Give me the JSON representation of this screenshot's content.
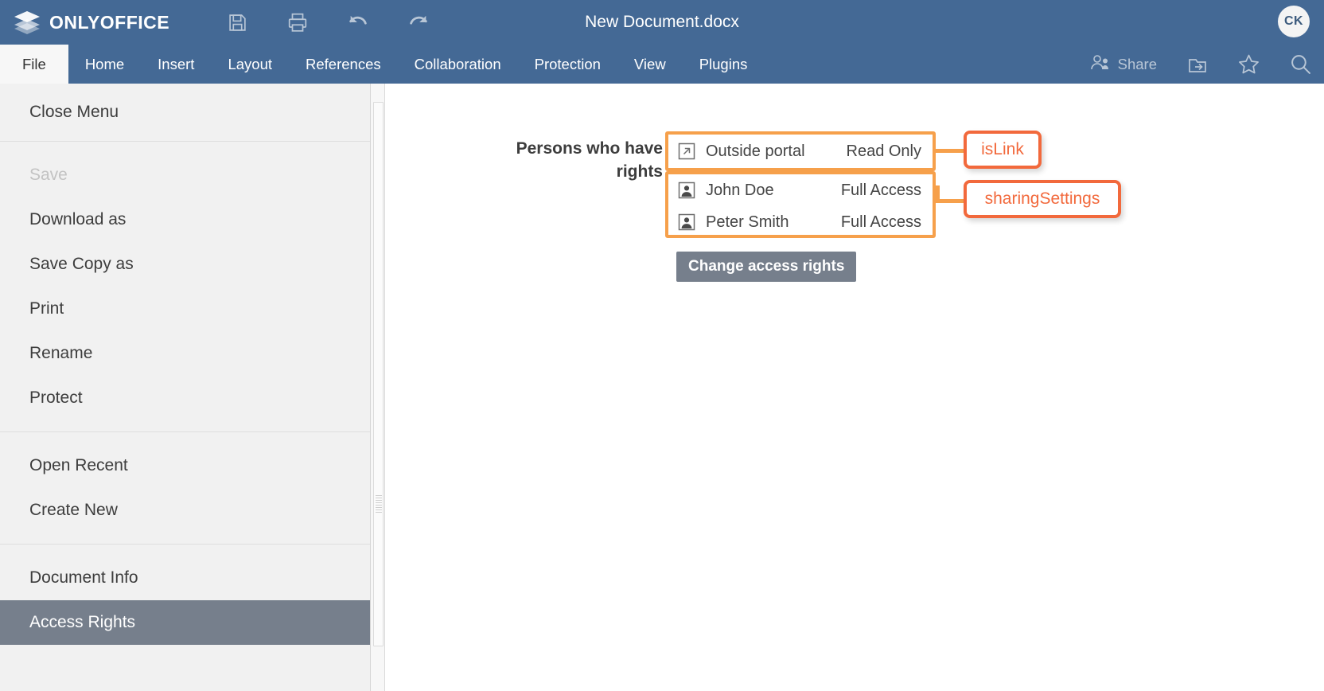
{
  "app": {
    "brand": "ONLYOFFICE",
    "logo_icon": "layers-stack-icon",
    "document_title": "New Document.docx",
    "avatar_initials": "CK"
  },
  "titlebar_tools": [
    {
      "name": "save-icon",
      "label": "Save"
    },
    {
      "name": "print-icon",
      "label": "Print"
    },
    {
      "name": "undo-icon",
      "label": "Undo"
    },
    {
      "name": "redo-icon",
      "label": "Redo"
    }
  ],
  "tabs": [
    {
      "label": "File",
      "active": true
    },
    {
      "label": "Home",
      "active": false
    },
    {
      "label": "Insert",
      "active": false
    },
    {
      "label": "Layout",
      "active": false
    },
    {
      "label": "References",
      "active": false
    },
    {
      "label": "Collaboration",
      "active": false
    },
    {
      "label": "Protection",
      "active": false
    },
    {
      "label": "View",
      "active": false
    },
    {
      "label": "Plugins",
      "active": false
    }
  ],
  "tab_tools": {
    "share_label": "Share",
    "share_icon": "people-share-icon",
    "open_location_icon": "open-folder-arrow-icon",
    "favorite_icon": "star-icon",
    "search_icon": "search-icon"
  },
  "sidebar": {
    "groups": [
      {
        "items": [
          {
            "label": "Close Menu",
            "state": "normal"
          }
        ]
      },
      {
        "items": [
          {
            "label": "Save",
            "state": "disabled"
          },
          {
            "label": "Download as",
            "state": "normal"
          },
          {
            "label": "Save Copy as",
            "state": "normal"
          },
          {
            "label": "Print",
            "state": "normal"
          },
          {
            "label": "Rename",
            "state": "normal"
          },
          {
            "label": "Protect",
            "state": "normal"
          }
        ]
      },
      {
        "items": [
          {
            "label": "Open Recent",
            "state": "normal"
          },
          {
            "label": "Create New",
            "state": "normal"
          }
        ]
      },
      {
        "items": [
          {
            "label": "Document Info",
            "state": "normal"
          },
          {
            "label": "Access Rights",
            "state": "selected"
          }
        ]
      }
    ]
  },
  "main": {
    "section_label": "Persons who have rights",
    "link_rows": [
      {
        "icon": "external-link-icon",
        "name": "Outside portal",
        "access": "Read Only"
      }
    ],
    "user_rows": [
      {
        "icon": "user-icon",
        "name": "John Doe",
        "access": "Full Access"
      },
      {
        "icon": "user-icon",
        "name": "Peter Smith",
        "access": "Full Access"
      }
    ],
    "change_button_label": "Change access rights"
  },
  "annotations": [
    {
      "label": "isLink",
      "target": "link_rows"
    },
    {
      "label": "sharingSettings",
      "target": "user_rows"
    }
  ],
  "colors": {
    "header_blue": "#446995",
    "highlight_orange": "#f6a04b",
    "callout_orange": "#f2693c",
    "selected_gray": "#767f8c",
    "sidebar_bg": "#f1f1f1"
  }
}
